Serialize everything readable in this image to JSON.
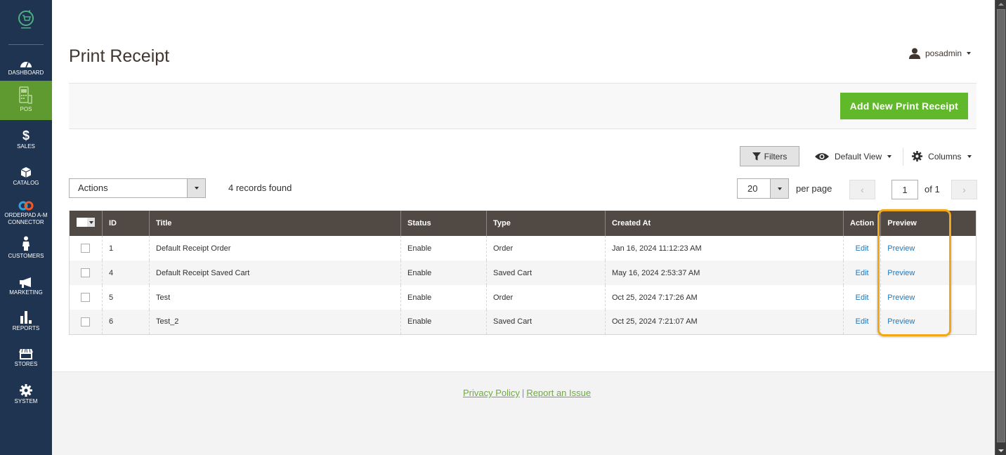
{
  "sidebar": {
    "logo_icon": "pos-cart-logo-icon",
    "items": [
      {
        "label": "DASHBOARD",
        "icon": "dashboard-gauge-icon",
        "active": false
      },
      {
        "label": "POS",
        "icon": "pos-terminal-icon",
        "active": true
      },
      {
        "label": "SALES",
        "icon": "dollar-icon",
        "active": false
      },
      {
        "label": "CATALOG",
        "icon": "box-icon",
        "active": false
      },
      {
        "label": "ORDERPAD A-M CONNECTOR",
        "label_line1": "ORDERPAD A-M",
        "label_line2": "CONNECTOR",
        "icon": "link-icon",
        "active": false
      },
      {
        "label": "CUSTOMERS",
        "icon": "person-icon",
        "active": false
      },
      {
        "label": "MARKETING",
        "icon": "megaphone-icon",
        "active": false
      },
      {
        "label": "REPORTS",
        "icon": "bar-chart-icon",
        "active": false
      },
      {
        "label": "STORES",
        "icon": "storefront-icon",
        "active": false
      },
      {
        "label": "SYSTEM",
        "icon": "gear-icon",
        "active": false
      }
    ]
  },
  "header": {
    "title": "Print Receipt",
    "user": "posadmin"
  },
  "actions_bar": {
    "add_button": "Add New Print Receipt"
  },
  "toolbar": {
    "filters": "Filters",
    "view": "Default View",
    "columns": "Columns",
    "mass_actions": "Actions",
    "records_found": "4 records found",
    "per_page_value": "20",
    "per_page_label": "per page",
    "current_page": "1",
    "of_pages": "of 1"
  },
  "grid": {
    "columns": [
      "ID",
      "Title",
      "Status",
      "Type",
      "Created At",
      "Action",
      "Preview"
    ],
    "rows": [
      {
        "id": "1",
        "title": "Default Receipt Order",
        "status": "Enable",
        "type": "Order",
        "created_at": "Jan 16, 2024 11:12:23 AM",
        "action": "Edit",
        "preview": "Preview"
      },
      {
        "id": "4",
        "title": "Default Receipt Saved Cart",
        "status": "Enable",
        "type": "Saved Cart",
        "created_at": "May 16, 2024 2:53:37 AM",
        "action": "Edit",
        "preview": "Preview"
      },
      {
        "id": "5",
        "title": "Test",
        "status": "Enable",
        "type": "Order",
        "created_at": "Oct 25, 2024 7:17:26 AM",
        "action": "Edit",
        "preview": "Preview"
      },
      {
        "id": "6",
        "title": "Test_2",
        "status": "Enable",
        "type": "Saved Cart",
        "created_at": "Oct 25, 2024 7:21:07 AM",
        "action": "Edit",
        "preview": "Preview"
      }
    ]
  },
  "footer": {
    "privacy": "Privacy Policy",
    "separator": "|",
    "report": "Report an Issue"
  },
  "colors": {
    "sidebar_bg": "#1e3450",
    "active_nav": "#5e9a2f",
    "primary_button": "#61b82b",
    "grid_header": "#514943",
    "link": "#1979c3",
    "highlight": "#f0a818",
    "footer_link": "#6eab3e"
  }
}
